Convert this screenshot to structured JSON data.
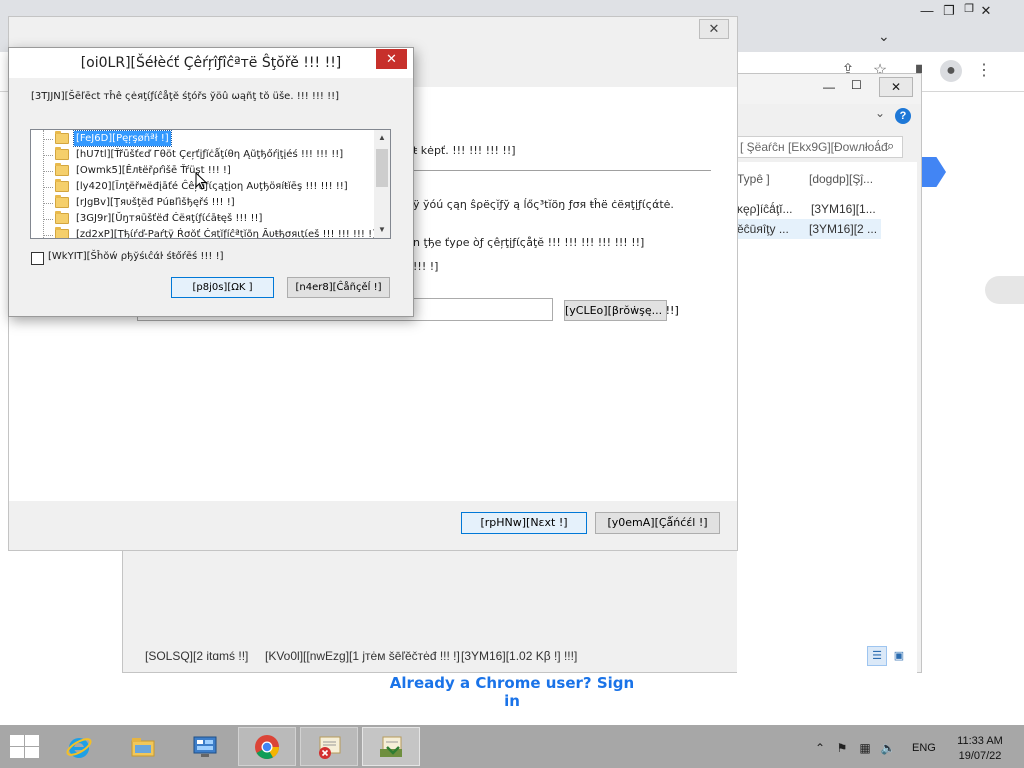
{
  "chrome": {
    "signin_link": "Already a Chrome user? Sign in"
  },
  "cert_manager": {
    "search_placeholder": "[ Şëaŕĉн [Ekx9G][Ðowлłoǻđ",
    "columns": [
      "Typê ]",
      "[dogdp][Şĵ..."
    ],
    "rows": [
      {
        "type": "ĸęρ]íĉǻţĭ...",
        "store": "[3YM16][1..."
      },
      {
        "type": "ěĉūяîţy ...",
        "store": "[3YM16][2 ..."
      }
    ],
    "status": {
      "items": "[SOLSQ][2 itɑmś !!]",
      "selected": "[KVo0l][[nwEzg][1 jтėм šēľĕčтėđ !!! !]",
      "size": "[3YM16][1.02 Kβ !] !!!]"
    }
  },
  "wizard": {
    "kept_text": "ŧ kėpť. !!! !!! !!! !!]",
    "specify_text": "ÿ ўóú ςąη ŝρёςĭƒў ą ĺőς³tĭöŋ ƒσя ŧĥё ċёяţįƒίςάtė.",
    "type_text": "n ţђе ťуρе òƒ ςêŗţįƒίςåţĕ !!! !!! !!! !!! !!! !!]",
    "short_text": "!!! !]",
    "browse_label": "[yCLEo][βrŏẇşę... !!]",
    "next_label": "[rpHNw][Nεxt !]",
    "cancel_label": "[y0emA][Çǻńćέl !]"
  },
  "dialog": {
    "title": "[oi0LR][Šéłèćť Çêŕŗîƒîĉªтë Ŝţŏřě !!! !!]",
    "instruction": "[3TJJN][Šēľēct тĥê ςėяţίƒίĉåţĕ śţóřs ўöû ωąñţ tŏ üše. !!! !!! !!]",
    "stores": [
      "[FeJ6D][Pęŗşøñªł !]",
      "[hU7tl][Ťřūšťєď Гθöt Çєŗťįƒĭċǻţίθη Ąũţђőŕįţįéś !!! !!! !!]",
      "[Owmk5][Êлŧёřρŕìšē Ťŕüşt !!! !]",
      "[ly420][Ĭлţёřмёđįāťé Ĉêŗŧíƒίςąţįοη Αυţђöяíŧĭēş !!! !!! !!]",
      "[rJgBv][Ţяυšţёđ Ρúвľìšђęřś !!! !]",
      "[3GJ9r][Ŭŋтяūšťёđ Ċёяţίƒίćāŧęš !!! !!]",
      "[zd2xP][Ţђίŕď-Ρаŕţÿ Ŕσŏť Ċяţĭƒíĉªţĭõη Āυŧђσяιţίеš !!! !!! !!! !]"
    ],
    "show_physical_label": "[WkYIT][Šĥŏẃ ρђўśιĉάŀ śŧőŕēś !!! !]",
    "ok_label": "[p8j0s][ΩK ]",
    "cancel_label": "[n4er8][Ĉåñçěĺ !]"
  },
  "taskbar": {
    "language": "ENG",
    "time": "11:33 AM",
    "date": "19/07/22"
  },
  "colors": {
    "taskbar_bg": "#a7a7a7",
    "selection_blue": "#3399ff",
    "close_red": "#c7302b",
    "link_blue": "#1a73e8",
    "chrome_blue": "#4285f4"
  }
}
